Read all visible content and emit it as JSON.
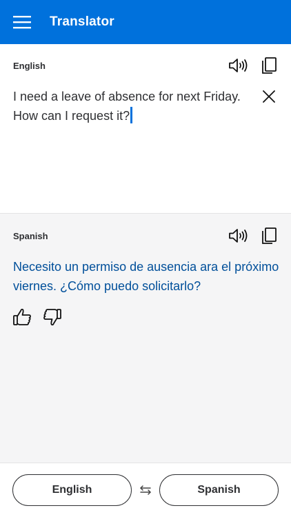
{
  "header": {
    "title": "Translator",
    "menu_icon": "hamburger-menu-icon",
    "background": "#0071dc"
  },
  "source": {
    "language": "English",
    "text": "I need a leave of absence for next Friday. How can I request it?"
  },
  "target": {
    "language": "Spanish",
    "text": "Necesito un permiso de ausencia ara el próximo viernes. ¿Cómo puedo solicitarlo?",
    "color": "#004f9a"
  },
  "icons": {
    "speaker": "speaker-icon",
    "copy": "copy-icon",
    "clear": "close-icon",
    "thumbs_up": "thumbs-up-icon",
    "thumbs_down": "thumbs-down-icon",
    "swap": "swap-arrows-icon"
  },
  "footer": {
    "source_button": "English",
    "target_button": "Spanish"
  }
}
